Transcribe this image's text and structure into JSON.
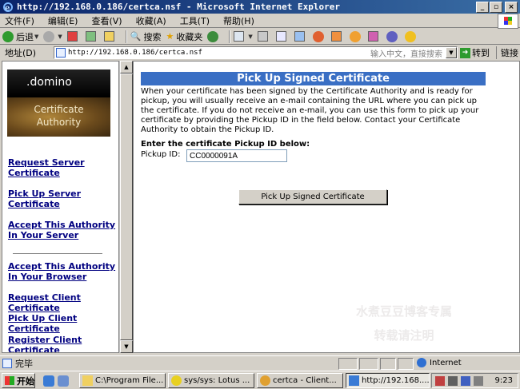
{
  "window": {
    "title": "http://192.168.0.186/certca.nsf - Microsoft Internet Explorer",
    "buttons": [
      "_",
      "▫",
      "×"
    ]
  },
  "menu": [
    "文件(F)",
    "编辑(E)",
    "查看(V)",
    "收藏(A)",
    "工具(T)",
    "帮助(H)"
  ],
  "toolbar": {
    "back": "后退",
    "search": "搜索",
    "favorites": "收藏夹"
  },
  "address": {
    "label": "地址(D)",
    "url": "http://192.168.0.186/certca.nsf",
    "hint": "输入中文，直接搜索",
    "go": "转到",
    "links": "链接"
  },
  "sidebar": {
    "logo_brand": ".domino",
    "logo_line1": "Certificate",
    "logo_line2": "Authority",
    "links": [
      "Request Server Certificate",
      "Pick Up Server Certificate",
      "Accept This Authority In Your Server",
      "Accept This Authority In Your Browser",
      "Request Client Certificate",
      "Pick Up Client Certificate",
      "Register Client Certificate"
    ]
  },
  "main": {
    "header": "Pick Up Signed Certificate",
    "description": "When your certificate has been signed by the Certificate Authority and is ready for pickup, you will usually receive an e-mail containing the URL where you can pick up the certificate. If you do not receive an e-mail, you can use this form to pick up your certificate by providing the Pickup ID in the field below. Contact your Certificate Authority to obtain the Pickup ID.",
    "prompt": "Enter the certificate Pickup ID below:",
    "pickup_label": "Pickup ID:",
    "pickup_value": "CC0000091A",
    "submit": "Pick Up Signed Certificate",
    "watermark_line1": "水煮豆豆博客专属",
    "watermark_line2": "转载请注明"
  },
  "status": {
    "text": "完毕",
    "zone": "Internet"
  },
  "taskbar": {
    "start": "开始",
    "tasks": [
      "C:\\Program File...",
      "sys/sys: Lotus ...",
      "certca - Client...",
      "http://192.168...."
    ],
    "clock": "9:23"
  },
  "colors": {
    "titlebar": "#0a246a",
    "header_bar": "#3a6fc4",
    "link": "#000080"
  }
}
